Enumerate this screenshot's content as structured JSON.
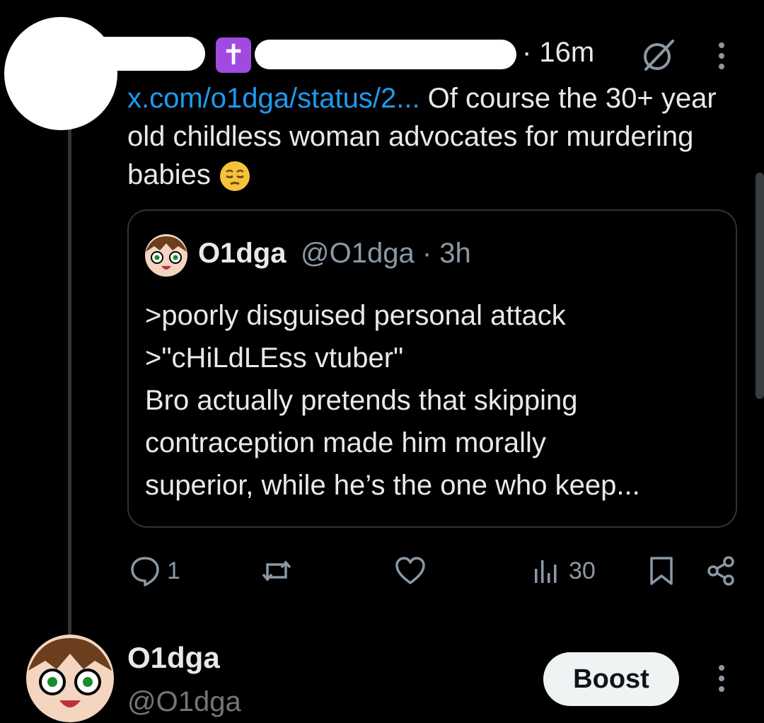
{
  "post": {
    "time": "· 16m",
    "link_text": "x.com/o1dga/status/2...",
    "text_after_link": " Of course the 30+ year old childless woman advocates for murdering babies"
  },
  "quote": {
    "name": "O1dga",
    "handle": "@O1dga · 3h",
    "lines": [
      ">poorly disguised personal attack",
      ">\"cHiLdLEss vtuber\"",
      "Bro actually pretends that skipping",
      "contraception made him morally",
      "superior, while he’s the one who keep..."
    ]
  },
  "actions": {
    "reply_count": "1",
    "repost_count": "",
    "like_count": "",
    "views_count": "30"
  },
  "next_post": {
    "name": "O1dga",
    "handle": "@O1dga",
    "boost_label": "Boost"
  },
  "colors": {
    "background": "#000000",
    "text": "#e7e9ea",
    "link": "#1d9bf0",
    "muted": "#8b98a5",
    "badge": "#a04ae0"
  }
}
